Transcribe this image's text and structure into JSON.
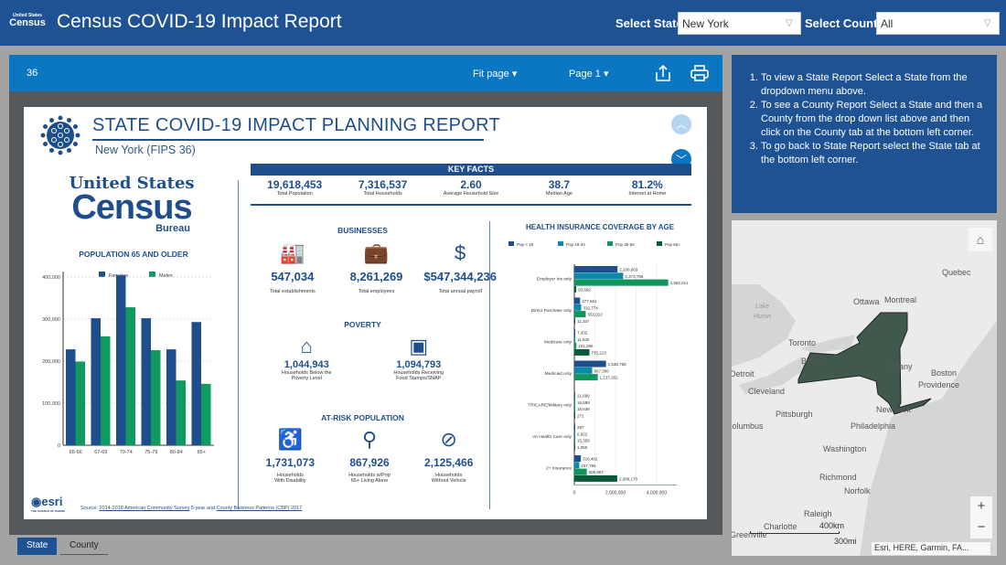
{
  "header": {
    "logo": "Census",
    "logo_sub": "United States",
    "logo_bureau": "Bureau",
    "title": "Census COVID-19 Impact Report",
    "state_label": "Select State:",
    "state_value": "New York",
    "county_label": "Select County:",
    "county_value": "All"
  },
  "viewer": {
    "page_number": "36",
    "fit_label": "Fit page",
    "page_label": "Page 1"
  },
  "report": {
    "title": "STATE COVID-19 IMPACT PLANNING REPORT",
    "subtitle": "New York  (FIPS 36)",
    "logo": {
      "line1": "United States",
      "line2": "Census",
      "line3": "Bureau"
    },
    "key_facts_title": "KEY FACTS",
    "key_facts": [
      {
        "value": "19,618,453",
        "label": "Total Population"
      },
      {
        "value": "7,316,537",
        "label": "Total Households"
      },
      {
        "value": "2.60",
        "label": "Average Household Size"
      },
      {
        "value": "38.7",
        "label": "Median Age"
      },
      {
        "value": "81.2%",
        "label": "Internet at Home"
      }
    ],
    "businesses_title": "BUSINESSES",
    "businesses": [
      {
        "value": "547,034",
        "label": "Total establishments",
        "icon": "factory"
      },
      {
        "value": "8,261,269",
        "label": "Total employees",
        "icon": "briefcase"
      },
      {
        "value": "$547,344,236",
        "label": "Total annual payroll",
        "icon": "dollar"
      }
    ],
    "poverty_title": "POVERTY",
    "poverty": [
      {
        "value": "1,044,943",
        "label1": "Households Below the",
        "label2": "Poverty Level",
        "icon": "house-down"
      },
      {
        "value": "1,094,793",
        "label1": "Households Receiving",
        "label2": "Food Stamps/SNAP",
        "icon": "wallet"
      }
    ],
    "atrisk_title": "AT-RISK POPULATION",
    "atrisk": [
      {
        "value": "1,731,073",
        "label1": "Households",
        "label2": "With Disability",
        "icon": "wheelchair"
      },
      {
        "value": "867,926",
        "label1": "Households w/Pop",
        "label2": "65+ Living Alone",
        "icon": "elderly"
      },
      {
        "value": "2,125,466",
        "label1": "Households",
        "label2": "Without Vehicle",
        "icon": "no-car"
      }
    ],
    "source_prefix": "Source: ",
    "source_link1": "2014-2018 American Community Survey",
    "source_mid": " 5-year and ",
    "source_link2": "County Business Patterns (CBP) 2017",
    "esri": "esri",
    "esri_tag": "THE SCIENCE OF WHERE"
  },
  "chart_data": [
    {
      "type": "bar",
      "title": "POPULATION 65 AND OLDER",
      "categories": [
        "65-66",
        "67-69",
        "70-74",
        "75-79",
        "80-84",
        "85+"
      ],
      "series": [
        {
          "name": "Females",
          "color": "#1f4e8c",
          "values": [
            228000,
            302000,
            404000,
            302000,
            228000,
            293000
          ]
        },
        {
          "name": "Males",
          "color": "#0f9a5f",
          "values": [
            199000,
            259000,
            328000,
            226000,
            154000,
            146000
          ]
        }
      ],
      "ylim": [
        0,
        400000
      ],
      "yticks": [
        "0",
        "100,000",
        "200,000",
        "300,000",
        "400,000"
      ],
      "legend": "top",
      "grid": true
    },
    {
      "type": "bar",
      "orientation": "horizontal",
      "title": "HEALTH INSURANCE COVERAGE BY AGE",
      "categories": [
        "Employer Ins only",
        "Direct Purchase only",
        "Medicare only",
        "Medicaid only",
        "TRICARE/Military only",
        "VA Health Care only",
        "2+ Insurance"
      ],
      "series": [
        {
          "name": "Pop < 19",
          "color": "#1f4e8c",
          "values": [
            2100063,
            277661,
            7332,
            1538758,
            21699,
            287,
            316402
          ],
          "labels": [
            "2,100,063",
            "277,661",
            "7,332",
            "1,538,758",
            "21,699",
            "287",
            "316,402"
          ]
        },
        {
          "name": "Pop 19-34",
          "color": "#0b8aa8",
          "values": [
            2373756,
            332774,
            11840,
            867300,
            16599,
            6922,
            237766
          ],
          "labels": [
            "2,373,756",
            "332,774",
            "11,840",
            "867,300",
            "16,599",
            "6,922",
            "237,766"
          ]
        },
        {
          "name": "Pop 35-64",
          "color": "#10955c",
          "values": [
            4562011,
            553012,
            101296,
            1137262,
            16036,
            15358,
            605867
          ],
          "labels": [
            "4,562,011",
            "553,012",
            "101,296",
            "1,137,262",
            "16,036",
            "15,358",
            "605,867"
          ]
        },
        {
          "name": "Pop 65+",
          "color": "#0a5a3a",
          "values": [
            93592,
            11157,
            735213,
            null,
            272,
            1050,
            2086170
          ],
          "labels": [
            "93,592",
            "11,157",
            "735,213",
            "",
            "272",
            "1,050",
            "2,086,170"
          ]
        }
      ],
      "xlim": [
        0,
        5000000
      ],
      "xticks": [
        "0",
        "2,000,000",
        "4,000,000"
      ],
      "legend": "top",
      "grid": true
    }
  ],
  "instructions": [
    "To view a State Report Select a State from the dropdown menu above.",
    "To see a County Report Select a State and then a County from the drop down list above and then click on the County tab at the bottom left corner.",
    "To go back to State Report select the State tab at the bottom left corner."
  ],
  "map": {
    "labels": [
      [
        "Quebec",
        230,
        52
      ],
      [
        "Ottawa",
        133,
        84
      ],
      [
        "Montreal",
        167,
        82
      ],
      [
        "Lake",
        26,
        91
      ],
      [
        "Huron",
        24,
        102
      ],
      [
        "Toronto",
        62,
        129
      ],
      [
        "Buffalo",
        76,
        149
      ],
      [
        "Detroit",
        -2,
        163
      ],
      [
        "Cleveland",
        18,
        182
      ],
      [
        "Albany",
        170,
        155
      ],
      [
        "Boston",
        218,
        162
      ],
      [
        "Providence",
        204,
        175
      ],
      [
        "New York",
        158,
        202
      ],
      [
        "Pittsburgh",
        48,
        207
      ],
      [
        "Columbus",
        -6,
        220
      ],
      [
        "Philadelphia",
        130,
        220
      ],
      [
        "Washington",
        100,
        245
      ],
      [
        "Richmond",
        96,
        276
      ],
      [
        "Norfolk",
        123,
        291
      ],
      [
        "Raleigh",
        79,
        316
      ],
      [
        "Charlotte",
        35,
        330
      ],
      [
        "Greenville",
        -2,
        339
      ]
    ],
    "scale_km": "400km",
    "scale_mi": "300mi",
    "attribution": "Esri, HERE, Garmin, FA...",
    "zoom_in": "+",
    "zoom_out": "−"
  },
  "tabs": [
    {
      "label": "State",
      "active": true
    },
    {
      "label": "County",
      "active": false
    }
  ],
  "colors": {
    "header": "#1f5293",
    "toolbar": "#0b77c2",
    "report_navy": "#1f4e8c",
    "ny_fill": "#3f5a4d"
  }
}
